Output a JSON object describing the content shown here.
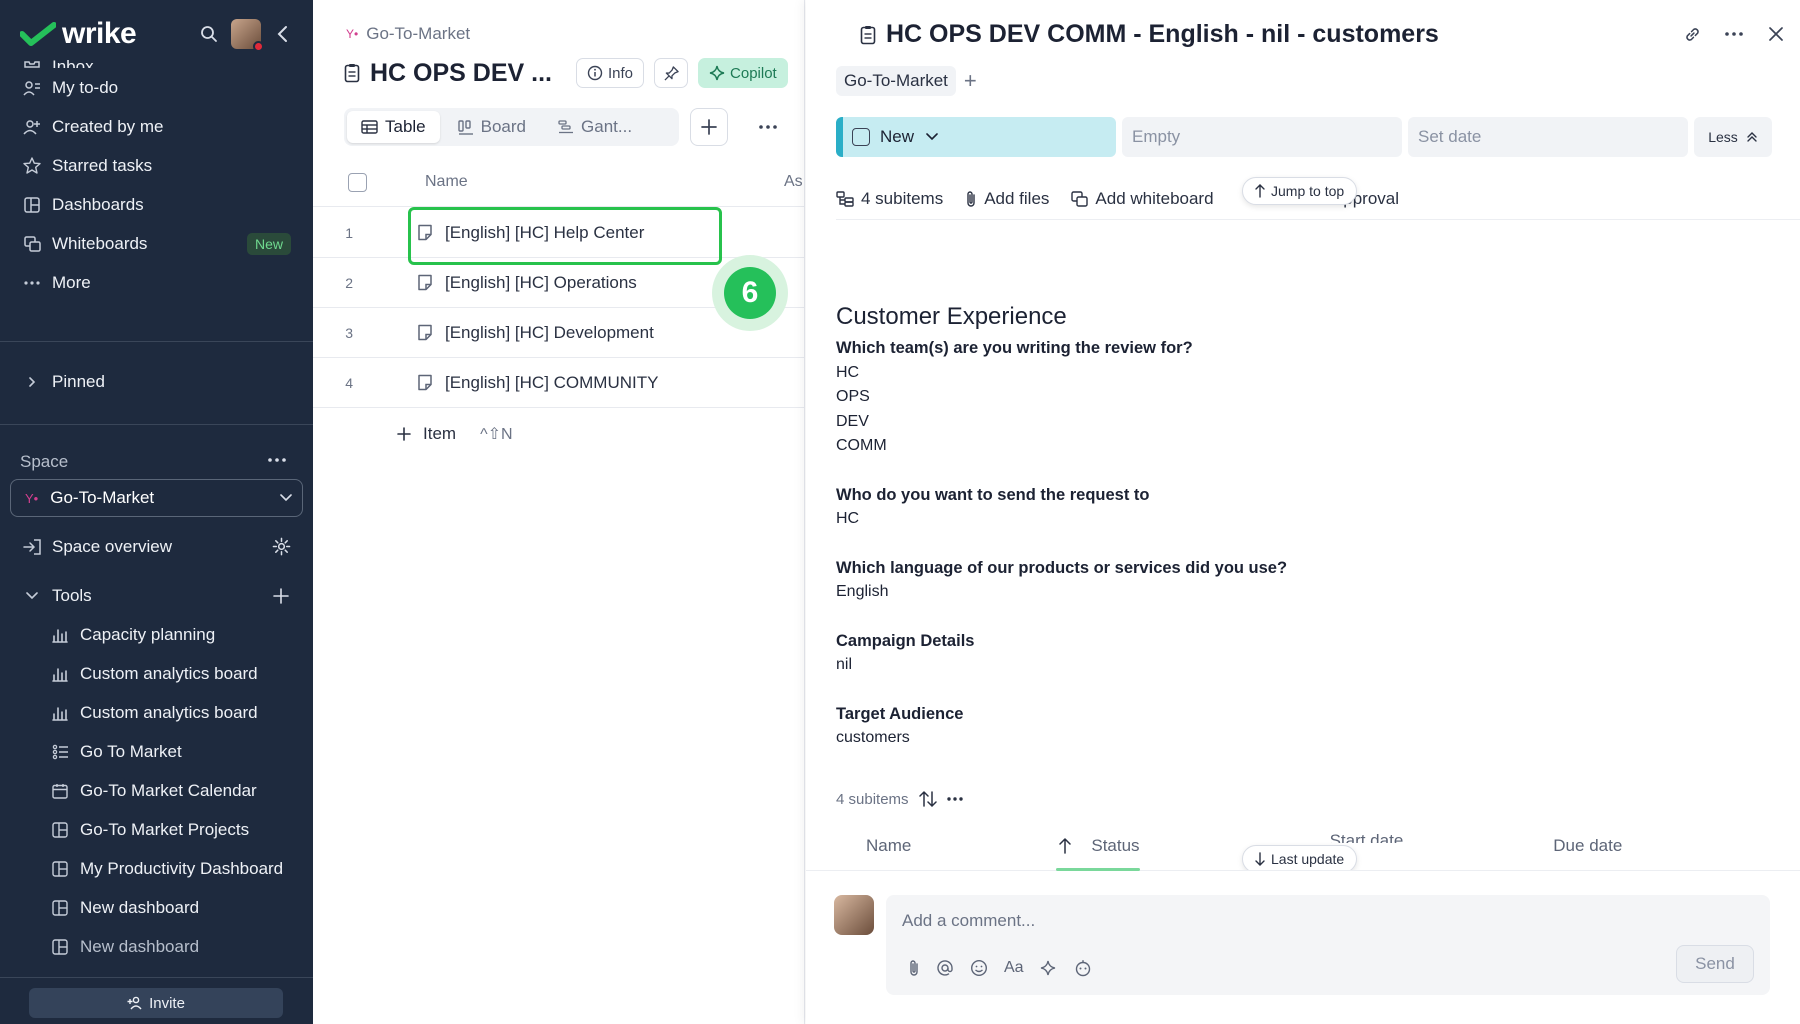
{
  "sidebar": {
    "brand": "wrike",
    "nav": {
      "inbox": "Inbox",
      "todo": "My to-do",
      "created": "Created by me",
      "starred": "Starred tasks",
      "dashboards": "Dashboards",
      "whiteboards": "Whiteboards",
      "whiteboards_badge": "New",
      "more": "More"
    },
    "pinned": "Pinned",
    "space_title": "Space",
    "space_selected": "Go-To-Market",
    "space_overview": "Space overview",
    "tools_title": "Tools",
    "tools": [
      {
        "label": "Capacity planning",
        "icon": "analytics-icon"
      },
      {
        "label": "Custom analytics board",
        "icon": "analytics-icon"
      },
      {
        "label": "Custom analytics board",
        "icon": "analytics-icon"
      },
      {
        "label": "Go To Market",
        "icon": "list-icon"
      },
      {
        "label": "Go-To Market Calendar",
        "icon": "calendar-icon"
      },
      {
        "label": "Go-To Market Projects",
        "icon": "dashboard-icon"
      },
      {
        "label": "My Productivity Dashboard",
        "icon": "dashboard-icon"
      },
      {
        "label": "New dashboard",
        "icon": "dashboard-icon"
      },
      {
        "label": "New dashboard",
        "icon": "dashboard-icon"
      }
    ],
    "invite": "Invite"
  },
  "middle": {
    "breadcrumb": "Go-To-Market",
    "title": "HC OPS DEV ...",
    "info": "Info",
    "copilot": "Copilot",
    "views": {
      "table": "Table",
      "board": "Board",
      "gantt": "Gant..."
    },
    "columns": {
      "name": "Name",
      "assignee": "As"
    },
    "rows": [
      {
        "num": "1",
        "name": "[English] [HC] Help Center"
      },
      {
        "num": "2",
        "name": "[English] [HC] Operations"
      },
      {
        "num": "3",
        "name": "[English] [HC] Development"
      },
      {
        "num": "4",
        "name": "[English] [HC] COMMUNITY"
      }
    ],
    "add_item": "Item",
    "add_item_shortcut": "^⇧N",
    "step_badge": "6"
  },
  "panel": {
    "title": "HC OPS DEV COMM - English - nil - customers",
    "tag": "Go-To-Market",
    "status": "New",
    "assignee_placeholder": "Empty",
    "date_placeholder": "Set date",
    "less": "Less",
    "actions": {
      "subitems": "4 subitems",
      "add_files": "Add files",
      "add_whiteboard": "Add whiteboard",
      "approval": ".pproval"
    },
    "jump_to_top": "Jump to top",
    "last_update": "Last update",
    "content": {
      "heading": "Customer Experience",
      "q1": "Which team(s) are you writing the review for?",
      "a1": [
        "HC",
        "OPS",
        "DEV",
        "COMM"
      ],
      "q2": "Who do you want to send the request to",
      "a2": "HC",
      "q3": "Which language of our products or services did you use?",
      "a3": "English",
      "q4": "Campaign Details",
      "a4": "nil",
      "q5": "Target Audience",
      "a5": "customers"
    },
    "subitems_label": "4 subitems",
    "subitems_columns": {
      "name": "Name",
      "status": "Status",
      "start": "Start date",
      "due": "Due date"
    },
    "comment_placeholder": "Add a comment...",
    "send": "Send",
    "format_label": "Aa"
  }
}
